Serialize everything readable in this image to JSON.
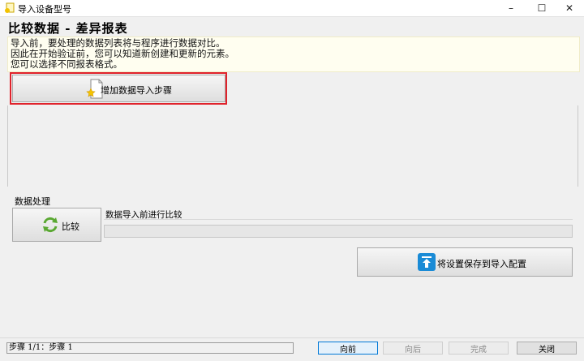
{
  "window": {
    "title": "导入设备型号",
    "minimize_glyph": "–",
    "maximize_glyph": "☐",
    "close_glyph": "✕"
  },
  "heading": "比较数据 - 差异报表",
  "info": {
    "line1": "导入前，要处理的数据列表将与程序进行数据对比。",
    "line2": "因此在开始验证前，您可以知道新创建和更新的元素。",
    "line3": "您可以选择不同报表格式。"
  },
  "add_step_button": {
    "label": "增加数据导入步骤",
    "icon": "document-star-icon"
  },
  "data_processing": {
    "section_label": "数据处理",
    "compare_button_label": "比较",
    "compare_icon": "refresh-icon",
    "status_title": "数据导入前进行比较",
    "progress": 0
  },
  "save_config_button": {
    "label": "将设置保存到导入配置",
    "icon": "upload-icon"
  },
  "footer": {
    "step_text": "步骤 1/1：步骤 1",
    "prev_label": "向前",
    "next_label": "向后",
    "finish_label": "完成",
    "close_label": "关闭"
  },
  "colors": {
    "highlight": "#e0222b",
    "info_background": "#fffef0",
    "accent_blue": "#1a8bd6",
    "refresh_green": "#5aa832"
  }
}
